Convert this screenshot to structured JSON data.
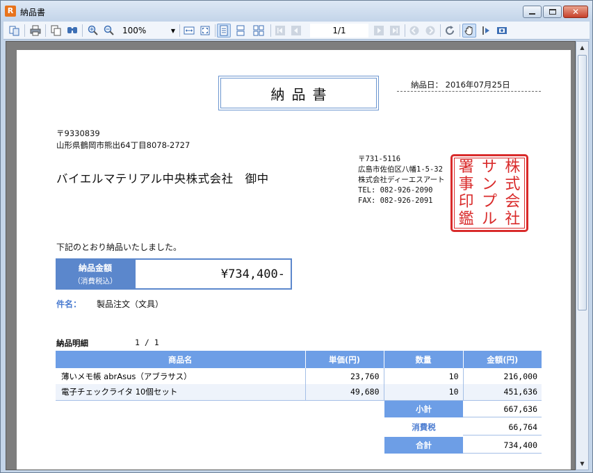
{
  "window": {
    "title": "納品書",
    "app_icon_letter": "R"
  },
  "toolbar": {
    "zoom": "100%",
    "page_indicator": "1/1",
    "icons": [
      "copy-pages-icon",
      "print-icon",
      "copy-icon",
      "find-icon",
      "zoom-in-icon",
      "zoom-out-icon",
      "fit-width-icon",
      "fit-page-icon",
      "single-page-icon",
      "continuous-icon",
      "multi-page-icon",
      "first-page-icon",
      "prev-page-icon",
      "next-page-icon",
      "last-page-icon",
      "back-icon",
      "forward-icon",
      "refresh-icon",
      "hand-tool-icon",
      "text-select-icon",
      "export-icon"
    ]
  },
  "document": {
    "title": "納品書",
    "delivery_date": "納品日： 2016年07月25日",
    "recipient_postal": "〒9330839",
    "recipient_address": "山形県鶴岡市熊出64丁目8078-2727",
    "recipient_name": "バイエルマテリアル中央株式会社　御中",
    "sender": {
      "postal": "〒731-5116",
      "address": "広島市佐伯区八幡1-5-32",
      "company": "株式会社ディーエスアート",
      "tel": "TEL: 082-926-2090",
      "fax": "FAX: 082-926-2091"
    },
    "seal_chars": [
      "株",
      "式",
      "会",
      "社",
      "サ",
      "ン",
      "プ",
      "ル",
      "署",
      "事",
      "印",
      "鑑"
    ],
    "intro": "下記のとおり納品いたしました。",
    "amount_label": "納品金額",
    "amount_sublabel": "（消費税込）",
    "amount_value": "¥734,400-",
    "subject_label": "件名：",
    "subject_value": "製品注文（文具）",
    "detail_label": "納品明細",
    "page_count": "1 / 1",
    "table": {
      "headers": [
        "商品名",
        "単価(円)",
        "数量",
        "金額(円)"
      ],
      "rows": [
        {
          "name": "薄いメモ帳 abrAsus（アブラサス）",
          "unit_price": "23,760",
          "qty": "10",
          "amount": "216,000"
        },
        {
          "name": "電子チェックライタ 10個セット",
          "unit_price": "49,680",
          "qty": "10",
          "amount": "451,636"
        }
      ]
    },
    "subtotal_label": "小計",
    "subtotal_value": "667,636",
    "tax_label": "消費税",
    "tax_value": "66,764",
    "total_label": "合計",
    "total_value": "734,400"
  },
  "colors": {
    "accent": "#6d9ee6",
    "seal": "#d92b2b",
    "label_blue": "#4a7bd0"
  }
}
